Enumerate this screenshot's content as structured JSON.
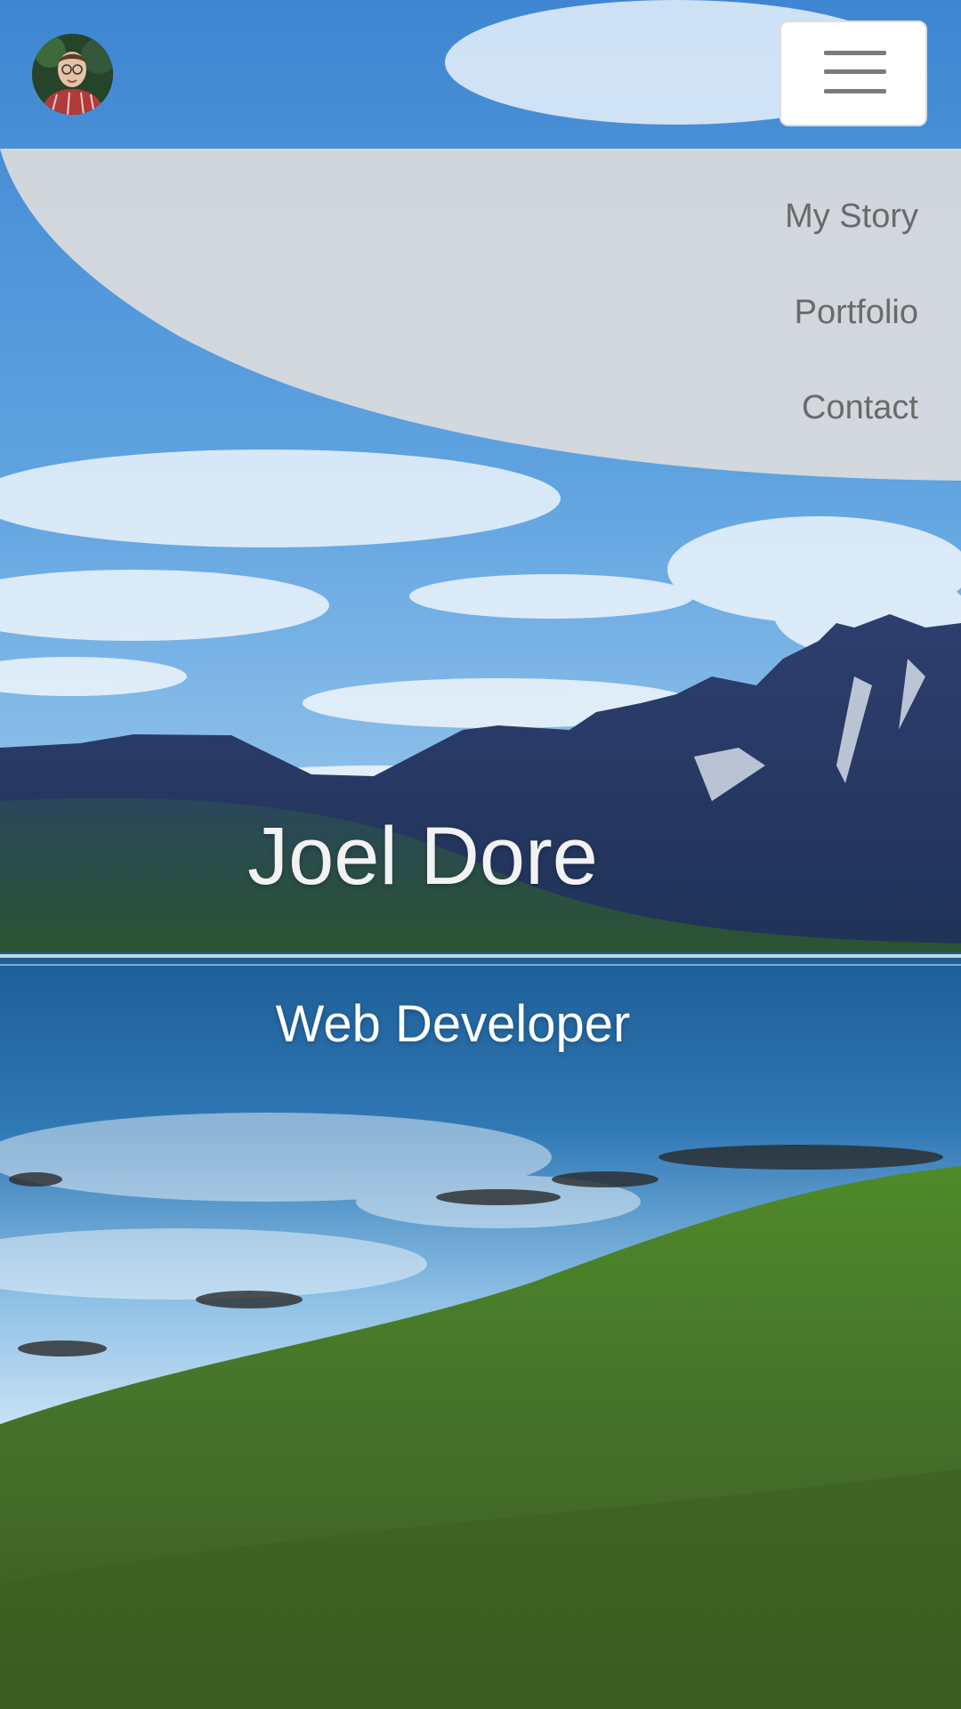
{
  "profile": {
    "avatar_icon": "person-portrait-icon"
  },
  "menu": {
    "toggle_icon": "hamburger-menu-icon",
    "items": [
      {
        "label": "My Story"
      },
      {
        "label": "Portfolio"
      },
      {
        "label": "Contact"
      }
    ]
  },
  "hero": {
    "name": "Joel Dore",
    "title": "Web Developer",
    "background_icon": "mountain-lake-landscape-image"
  },
  "colors": {
    "menu_panel": "#dcdcdc",
    "nav_text": "#6a6a6a",
    "hero_text": "#ffffff",
    "sky": "#4a8fd4",
    "grass": "#4f7d2a"
  }
}
